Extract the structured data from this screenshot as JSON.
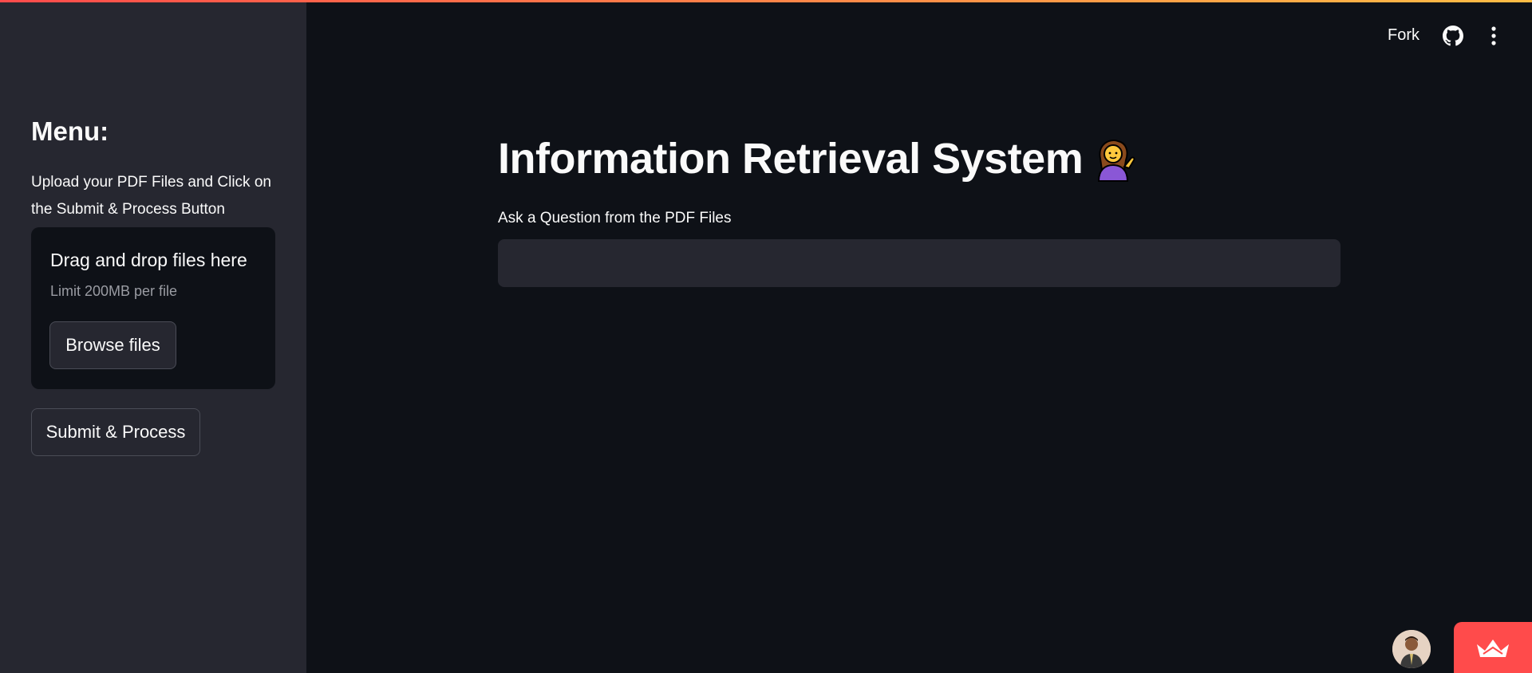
{
  "header": {
    "fork_label": "Fork",
    "github_icon": "github-icon",
    "menu_icon": "more-vertical-icon"
  },
  "sidebar": {
    "heading": "Menu:",
    "description": "Upload your PDF Files and Click on the Submit & Process Button",
    "uploader": {
      "title": "Drag and drop files here",
      "limit": "Limit 200MB per file",
      "browse_label": "Browse files"
    },
    "submit_label": "Submit & Process"
  },
  "main": {
    "title": "Information Retrieval System",
    "title_emoji": "woman-tipping-hand-emoji",
    "question_label": "Ask a Question from the PDF Files",
    "question_value": ""
  },
  "colors": {
    "background": "#0e1117",
    "sidebar": "#262730",
    "accent": "#ff4b4b"
  }
}
